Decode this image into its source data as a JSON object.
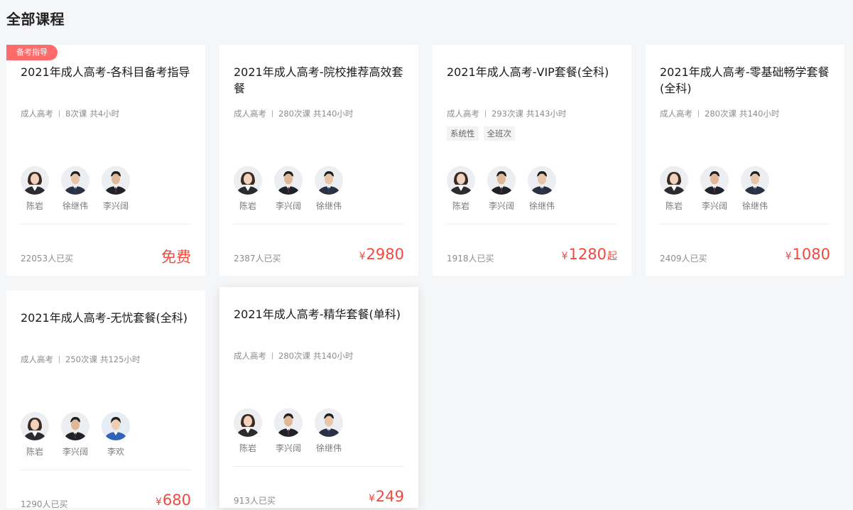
{
  "page": {
    "title": "全部课程"
  },
  "cards": [
    {
      "badge": "备考指导",
      "title": "2021年成人高考-各科目备考指导",
      "category": "成人高考",
      "lessons": "8次课",
      "hours": "共4小时",
      "tags": [],
      "teachers": [
        {
          "name": "陈岩",
          "avatar": "female-teacher-avatar"
        },
        {
          "name": "徐继伟",
          "avatar": "male-teacher-avatar"
        },
        {
          "name": "李兴阔",
          "avatar": "male-teacher-avatar"
        }
      ],
      "sold": "22053人已买",
      "price_free": "免费"
    },
    {
      "title": "2021年成人高考-院校推荐高效套餐",
      "category": "成人高考",
      "lessons": "280次课",
      "hours": "共140小时",
      "tags": [],
      "teachers": [
        {
          "name": "陈岩",
          "avatar": "female-teacher-avatar"
        },
        {
          "name": "李兴阔",
          "avatar": "male-teacher-avatar"
        },
        {
          "name": "徐继伟",
          "avatar": "male-teacher-avatar"
        }
      ],
      "sold": "2387人已买",
      "currency": "¥",
      "price": "2980"
    },
    {
      "title": "2021年成人高考-VIP套餐(全科)",
      "category": "成人高考",
      "lessons": "293次课",
      "hours": "共143小时",
      "tags": [
        "系统性",
        "全班次"
      ],
      "teachers": [
        {
          "name": "陈岩",
          "avatar": "female-teacher-avatar"
        },
        {
          "name": "李兴阔",
          "avatar": "male-teacher-avatar"
        },
        {
          "name": "徐继伟",
          "avatar": "male-teacher-avatar"
        }
      ],
      "sold": "1918人已买",
      "currency": "¥",
      "price": "1280",
      "price_suffix": "起"
    },
    {
      "title": "2021年成人高考-零基础畅学套餐(全科)",
      "category": "成人高考",
      "lessons": "280次课",
      "hours": "共140小时",
      "tags": [],
      "teachers": [
        {
          "name": "陈岩",
          "avatar": "female-teacher-avatar"
        },
        {
          "name": "李兴阔",
          "avatar": "male-teacher-avatar"
        },
        {
          "name": "徐继伟",
          "avatar": "male-teacher-avatar"
        }
      ],
      "sold": "2409人已买",
      "currency": "¥",
      "price": "1080"
    },
    {
      "title": "2021年成人高考-无忧套餐(全科)",
      "category": "成人高考",
      "lessons": "250次课",
      "hours": "共125小时",
      "tags": [],
      "teachers": [
        {
          "name": "陈岩",
          "avatar": "female-teacher-avatar"
        },
        {
          "name": "李兴阔",
          "avatar": "male-teacher-avatar"
        },
        {
          "name": "李欢",
          "avatar": "male-teacher-blue-avatar"
        }
      ],
      "sold": "1290人已买",
      "currency": "¥",
      "price": "680"
    },
    {
      "title": "2021年成人高考-精华套餐(单科)",
      "category": "成人高考",
      "lessons": "280次课",
      "hours": "共140小时",
      "tags": [],
      "teachers": [
        {
          "name": "陈岩",
          "avatar": "female-teacher-avatar"
        },
        {
          "name": "李兴阔",
          "avatar": "male-teacher-avatar"
        },
        {
          "name": "徐继伟",
          "avatar": "male-teacher-avatar"
        }
      ],
      "sold": "913人已买",
      "currency": "¥",
      "price": "249"
    }
  ],
  "colors": {
    "accent": "#f04a3e",
    "badge": "#ff6b6b",
    "background": "#f5f6f7"
  }
}
